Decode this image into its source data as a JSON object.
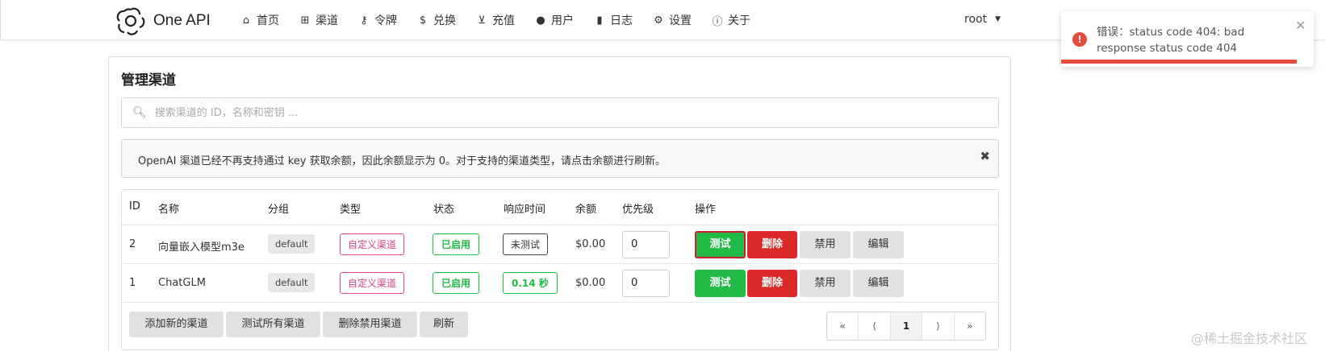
{
  "app": {
    "name": "One API"
  },
  "nav": [
    {
      "icon": "home-icon",
      "glyph": "⌂",
      "label": "首页"
    },
    {
      "icon": "sitemap-icon",
      "glyph": "⊞",
      "label": "渠道"
    },
    {
      "icon": "key-icon",
      "glyph": "⚷",
      "label": "令牌"
    },
    {
      "icon": "dollar-icon",
      "glyph": "$",
      "label": "兑换"
    },
    {
      "icon": "cart-icon",
      "glyph": "⊻",
      "label": "充值"
    },
    {
      "icon": "user-icon",
      "glyph": "●",
      "label": "用户"
    },
    {
      "icon": "book-icon",
      "glyph": "▮",
      "label": "日志"
    },
    {
      "icon": "gear-icon",
      "glyph": "⚙",
      "label": "设置"
    },
    {
      "icon": "info-icon",
      "glyph": "ⓘ",
      "label": "关于"
    }
  ],
  "user": {
    "name": "root"
  },
  "toast": {
    "message": "错误：status code 404: bad response status code 404",
    "color": "#e74c3c"
  },
  "page": {
    "title": "管理渠道",
    "search_placeholder": "搜索渠道的 ID，名称和密钥 ...",
    "notice": "OpenAI 渠道已经不再支持通过 key 获取余额，因此余额显示为 0。对于支持的渠道类型，请点击余额进行刷新。"
  },
  "table": {
    "headers": [
      "ID",
      "名称",
      "分组",
      "类型",
      "状态",
      "响应时间",
      "余额",
      "优先级",
      "操作"
    ],
    "rows": [
      {
        "id": "2",
        "name": "向量嵌入模型m3e",
        "group": "default",
        "type": "自定义渠道",
        "status": "已启用",
        "response": "未测试",
        "balance": "$0.00",
        "priority": "0"
      },
      {
        "id": "1",
        "name": "ChatGLM",
        "group": "default",
        "type": "自定义渠道",
        "status": "已启用",
        "response": "0.14 秒",
        "balance": "$0.00",
        "priority": "0"
      }
    ],
    "actions": {
      "test": "测试",
      "delete": "删除",
      "disable": "禁用",
      "edit": "编辑"
    }
  },
  "footer": {
    "add": "添加新的渠道",
    "test_all": "测试所有渠道",
    "delete_disabled": "删除禁用渠道",
    "refresh": "刷新"
  },
  "pagination": {
    "first": "«",
    "prev": "⟨",
    "current": "1",
    "next": "⟩",
    "last": "»"
  },
  "watermark": "@稀土掘金技术社区",
  "colors": {
    "green": "#21ba45",
    "red": "#db2828",
    "pink": "#d6458f"
  }
}
